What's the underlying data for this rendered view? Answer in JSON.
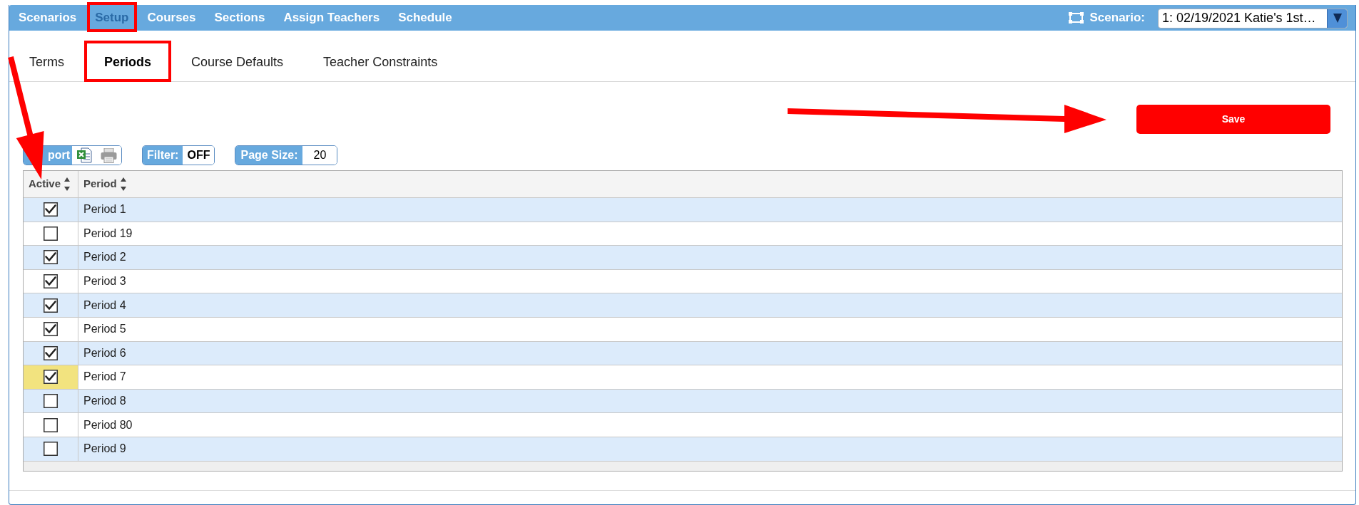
{
  "nav": {
    "items": [
      {
        "label": "Scenarios",
        "selected": false,
        "annotated": false
      },
      {
        "label": "Setup",
        "selected": true,
        "annotated": true
      },
      {
        "label": "Courses",
        "selected": false,
        "annotated": false
      },
      {
        "label": "Sections",
        "selected": false,
        "annotated": false
      },
      {
        "label": "Assign Teachers",
        "selected": false,
        "annotated": false
      },
      {
        "label": "Schedule",
        "selected": false,
        "annotated": false
      }
    ],
    "scenario": {
      "label": "Scenario:",
      "value": "1: 02/19/2021 Katie's 1st…"
    }
  },
  "tabs": [
    {
      "label": "Terms",
      "selected": false,
      "annotated": false
    },
    {
      "label": "Periods",
      "selected": true,
      "annotated": true
    },
    {
      "label": "Course Defaults",
      "selected": false,
      "annotated": false
    },
    {
      "label": "Teacher Constraints",
      "selected": false,
      "annotated": false
    }
  ],
  "save_button": "Save",
  "toolbar": {
    "export": "port",
    "filter": {
      "label": "Filter:",
      "value": "OFF"
    },
    "page_size": {
      "label": "Page Size:",
      "value": "20"
    }
  },
  "table": {
    "columns": [
      "Active",
      "Period"
    ],
    "rows": [
      {
        "active": true,
        "highlighted": false,
        "period": "Period 1"
      },
      {
        "active": false,
        "highlighted": false,
        "period": "Period 19"
      },
      {
        "active": true,
        "highlighted": false,
        "period": "Period 2"
      },
      {
        "active": true,
        "highlighted": false,
        "period": "Period 3"
      },
      {
        "active": true,
        "highlighted": false,
        "period": "Period 4"
      },
      {
        "active": true,
        "highlighted": false,
        "period": "Period 5"
      },
      {
        "active": true,
        "highlighted": false,
        "period": "Period 6"
      },
      {
        "active": true,
        "highlighted": true,
        "period": "Period 7"
      },
      {
        "active": false,
        "highlighted": false,
        "period": "Period 8"
      },
      {
        "active": false,
        "highlighted": false,
        "period": "Period 80"
      },
      {
        "active": false,
        "highlighted": false,
        "period": "Period 9"
      }
    ]
  }
}
